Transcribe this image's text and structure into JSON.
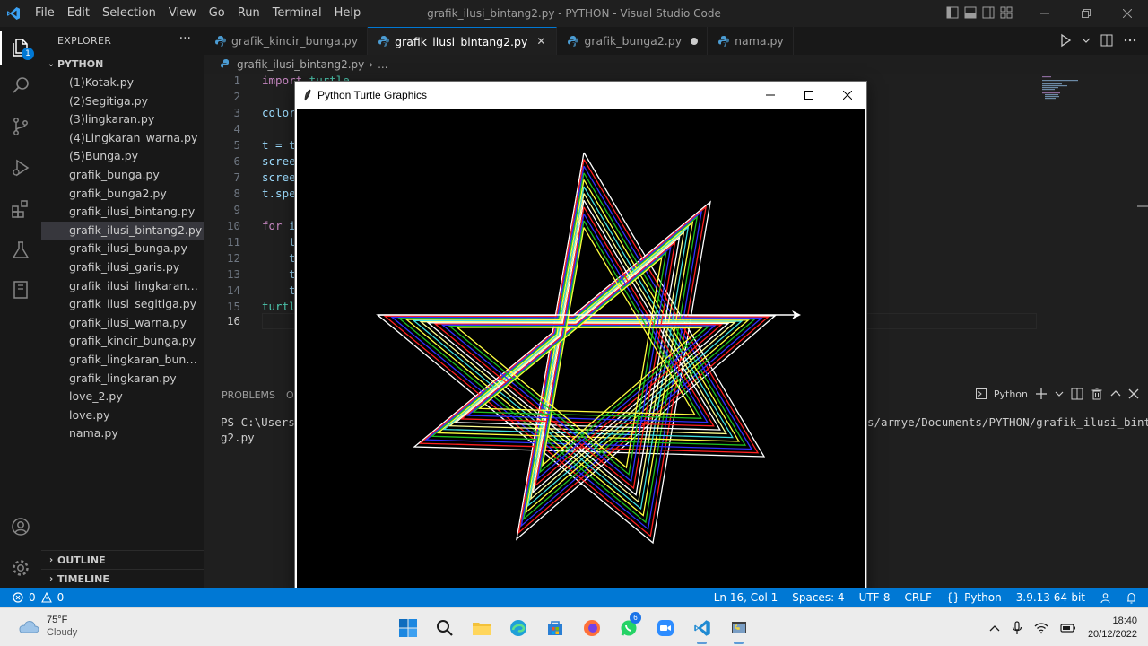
{
  "window": {
    "title": "grafik_ilusi_bintang2.py - PYTHON - Visual Studio Code",
    "menu": [
      "File",
      "Edit",
      "Selection",
      "View",
      "Go",
      "Run",
      "Terminal",
      "Help"
    ]
  },
  "activity_bar": {
    "explorer_badge": "1"
  },
  "sidebar": {
    "header": "EXPLORER",
    "more": "···",
    "folder": "PYTHON",
    "files": [
      "(1)Kotak.py",
      "(2)Segitiga.py",
      "(3)lingkaran.py",
      "(4)Lingkaran_warna.py",
      "(5)Bunga.py",
      "grafik_bunga.py",
      "grafik_bunga2.py",
      "grafik_ilusi_bintang.py",
      "grafik_ilusi_bintang2.py",
      "grafik_ilusi_bunga.py",
      "grafik_ilusi_garis.py",
      "grafik_ilusi_lingkaran_keo...",
      "grafik_ilusi_segitiga.py",
      "grafik_ilusi_warna.py",
      "grafik_kincir_bunga.py",
      "grafik_lingkaran_bunga.py",
      "grafik_lingkaran.py",
      "love_2.py",
      "love.py",
      "nama.py"
    ],
    "selected_file": "grafik_ilusi_bintang2.py",
    "outline": "OUTLINE",
    "timeline": "TIMELINE"
  },
  "tabs": [
    {
      "label": "grafik_kincir_bunga.py",
      "state": "normal"
    },
    {
      "label": "grafik_ilusi_bintang2.py",
      "state": "active"
    },
    {
      "label": "grafik_bunga2.py",
      "state": "modified"
    },
    {
      "label": "nama.py",
      "state": "normal"
    }
  ],
  "breadcrumb": {
    "file": "grafik_ilusi_bintang2.py",
    "sep": "›",
    "rest": "..."
  },
  "editor": {
    "line_numbers": [
      "1",
      "2",
      "3",
      "4",
      "5",
      "6",
      "7",
      "8",
      "9",
      "10",
      "11",
      "12",
      "13",
      "14",
      "15",
      "16"
    ],
    "active_line": "16",
    "code": {
      "l1_kw": "import",
      "l1_mod": " turtle",
      "l3": "color",
      "l5": "t = t",
      "l6": "scree",
      "l7": "scree",
      "l8": "t.spe",
      "l10_kw": "for",
      "l10_rest": " i",
      "l11": "    t",
      "l12": "    t",
      "l13": "    t",
      "l14": "    t",
      "l15": "turtl"
    }
  },
  "panel": {
    "tabs": [
      "PROBLEMS",
      "O"
    ],
    "terminal_label": "Python",
    "terminal_left_1": "PS C:\\Users\\",
    "terminal_left_2": "g2.py",
    "terminal_right": "s/armye/Documents/PYTHON/grafik_ilusi_bintan"
  },
  "turtle_window": {
    "title": "Python Turtle Graphics",
    "background": "#000000"
  },
  "status_bar": {
    "errors": "0",
    "warnings": "0",
    "position": "Ln 16, Col 1",
    "spaces": "Spaces: 4",
    "encoding": "UTF-8",
    "eol": "CRLF",
    "language": "Python",
    "interpreter": "3.9.13 64-bit",
    "accent": "#0078d4"
  },
  "taskbar": {
    "weather_temp": "75°F",
    "weather_desc": "Cloudy",
    "whatsapp_badge": "6",
    "time": "18:40",
    "date": "20/12/2022"
  },
  "star_colors": [
    "#ffffff",
    "#ff2020",
    "#3030ff",
    "#20c020",
    "#ffff40",
    "#40e0e0",
    "#ffff90"
  ]
}
